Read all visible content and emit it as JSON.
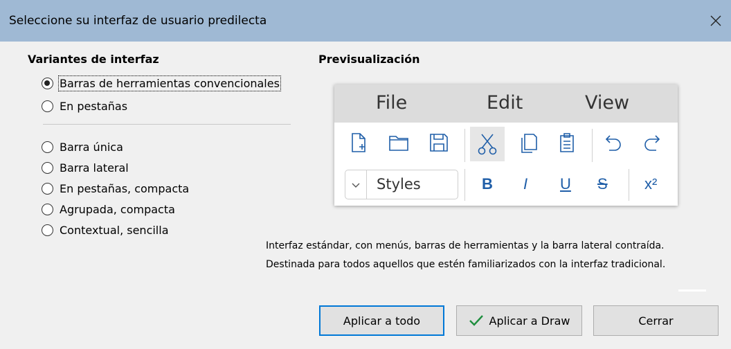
{
  "dialog": {
    "title": "Seleccione su interfaz de usuario predilecta"
  },
  "variants": {
    "heading": "Variantes de interfaz",
    "primary": [
      {
        "label": "Barras de herramientas convencionales",
        "checked": true
      },
      {
        "label": "En pestañas",
        "checked": false
      }
    ],
    "secondary": [
      {
        "label": "Barra única",
        "checked": false
      },
      {
        "label": "Barra lateral",
        "checked": false
      },
      {
        "label": "En pestañas, compacta",
        "checked": false
      },
      {
        "label": "Agrupada, compacta",
        "checked": false
      },
      {
        "label": "Contextual, sencilla",
        "checked": false
      }
    ]
  },
  "preview": {
    "heading": "Previsualización",
    "menus": [
      "File",
      "Edit",
      "View"
    ],
    "styles_label": "Styles",
    "format_buttons": [
      "B",
      "I",
      "U",
      "S",
      "x²"
    ],
    "icons": [
      "new-document-icon",
      "open-folder-icon",
      "save-icon",
      "cut-icon",
      "copy-icon",
      "paste-icon",
      "undo-icon",
      "redo-icon"
    ]
  },
  "description": {
    "line1": "Interfaz estándar, con menús, barras de herramientas y la barra lateral contraída.",
    "line2": "Destinada para todos aquellos que estén familiarizados con la interfaz tradicional."
  },
  "buttons": {
    "apply_all": "Aplicar a todo",
    "apply_draw": "Aplicar a Draw",
    "close": "Cerrar"
  },
  "colors": {
    "titlebar": "#9fb9d4",
    "preview_accent": "#1f5ea8",
    "check_green": "#1e8e3e"
  }
}
